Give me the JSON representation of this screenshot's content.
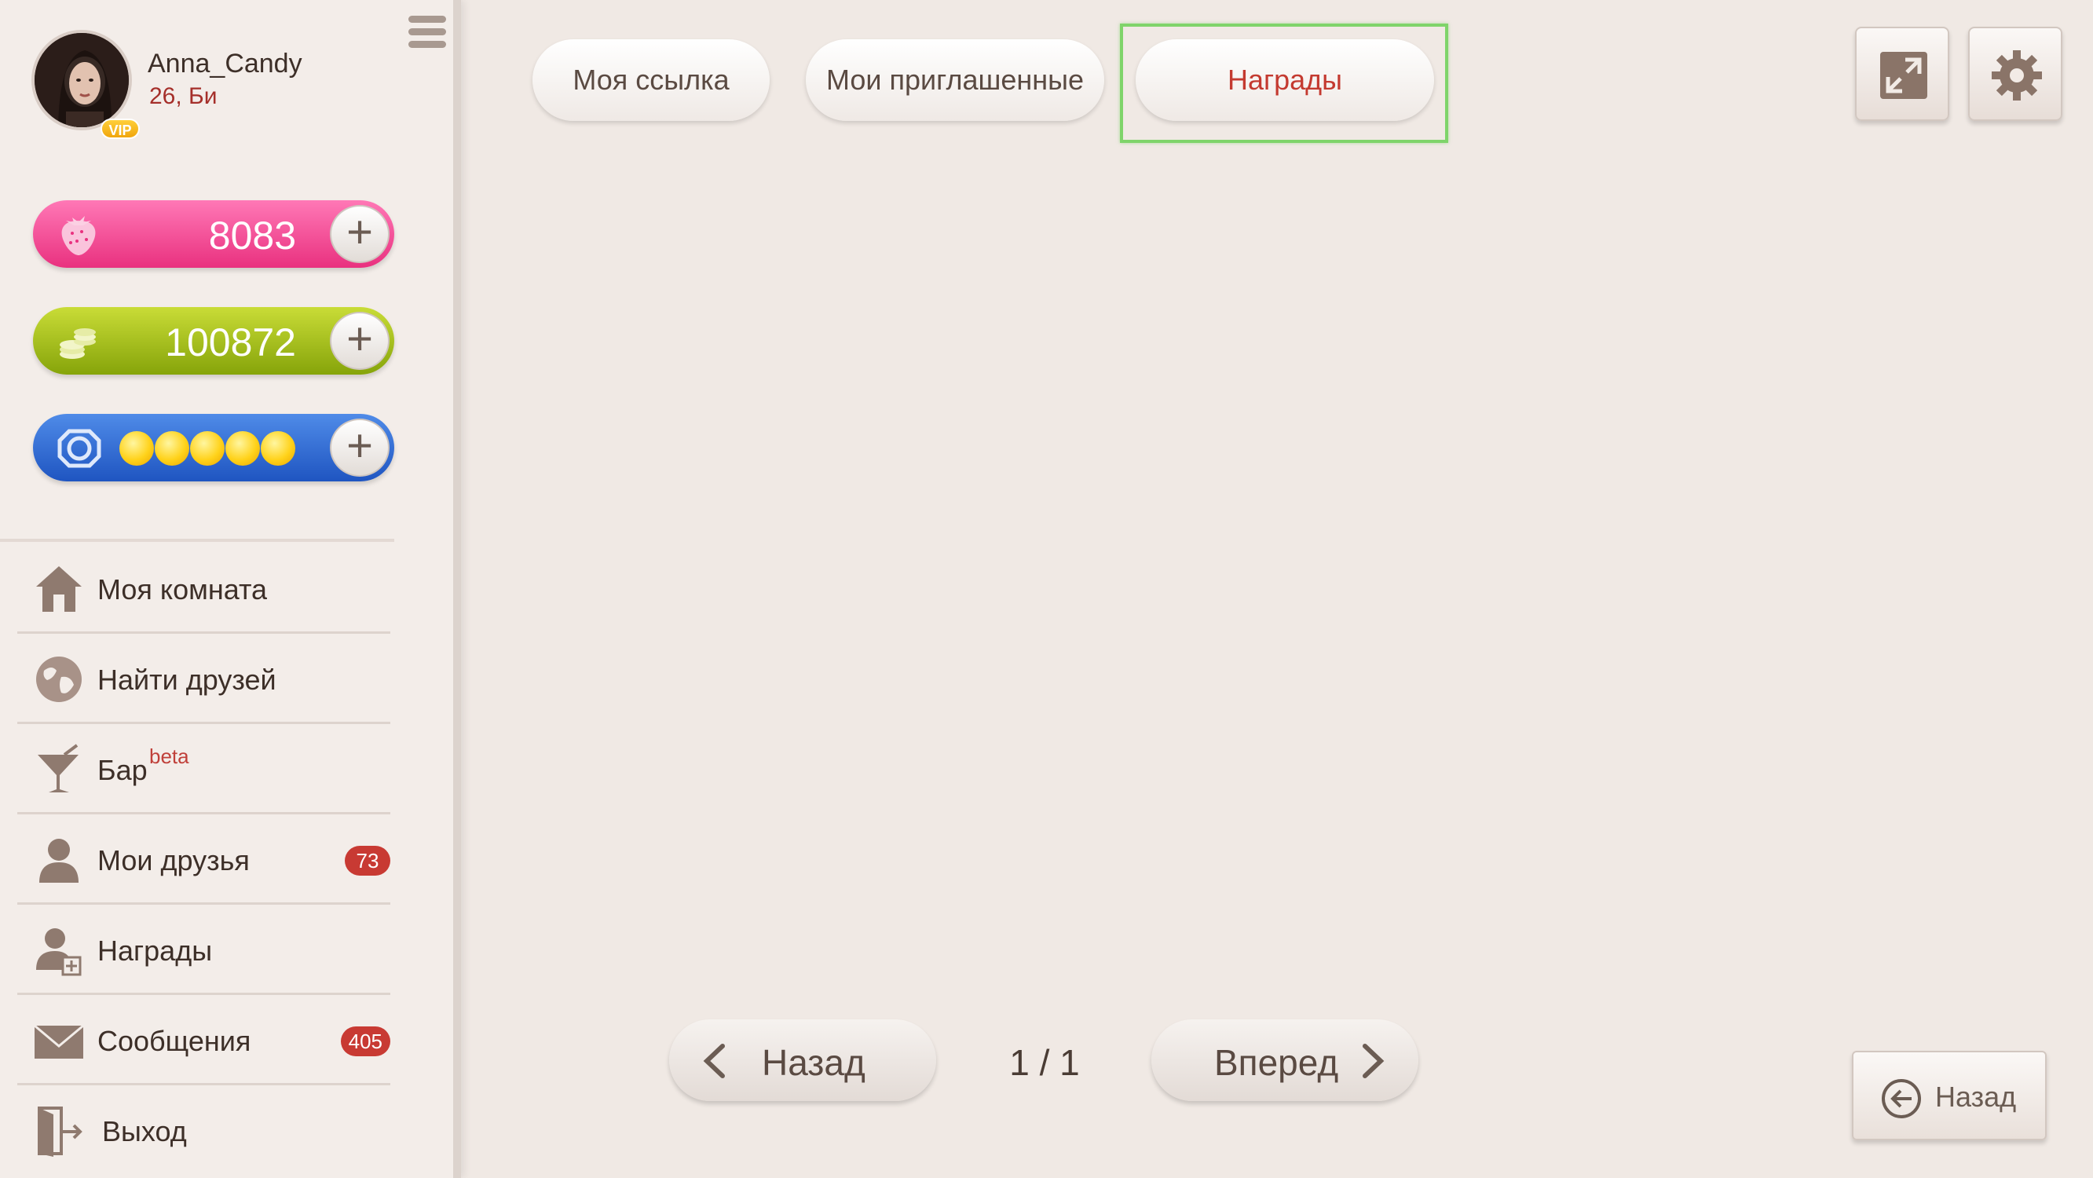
{
  "profile": {
    "username": "Anna_Candy",
    "info": "26, Би",
    "vip_badge": "VIP"
  },
  "currencies": {
    "hearts": {
      "value": "8083",
      "icon": "strawberry-icon",
      "color": "#e9317f"
    },
    "coins": {
      "value": "100872",
      "icon": "coins-icon",
      "color": "#86a40a"
    },
    "energy": {
      "icon": "token-icon",
      "stars_count": 5,
      "color": "#1f55c1"
    },
    "plus_label": "+"
  },
  "nav": {
    "items": [
      {
        "label": "Моя комната",
        "icon": "house-icon"
      },
      {
        "label": "Найти друзей",
        "icon": "globe-icon"
      },
      {
        "label": "Бар",
        "superscript": "beta",
        "icon": "cocktail-icon"
      },
      {
        "label": "Мои друзья",
        "badge": "73",
        "icon": "person-icon"
      },
      {
        "label": "Награды",
        "icon": "person-award-icon"
      },
      {
        "label": "Сообщения",
        "badge": "405",
        "icon": "envelope-icon"
      },
      {
        "label": "Выход",
        "icon": "exit-door-icon"
      }
    ]
  },
  "tabs": [
    {
      "label": "Моя ссылка"
    },
    {
      "label": "Мои приглашенные"
    },
    {
      "label": "Награды",
      "active": true
    }
  ],
  "pager": {
    "prev_label": "Назад",
    "next_label": "Вперед",
    "indicator": "1 / 1"
  },
  "back_button": {
    "label": "Назад"
  },
  "colors": {
    "background": "#f0e9e4",
    "active_tab_text": "#c43a30",
    "badge": "#c83a33",
    "highlight_frame": "#7fd46a"
  }
}
